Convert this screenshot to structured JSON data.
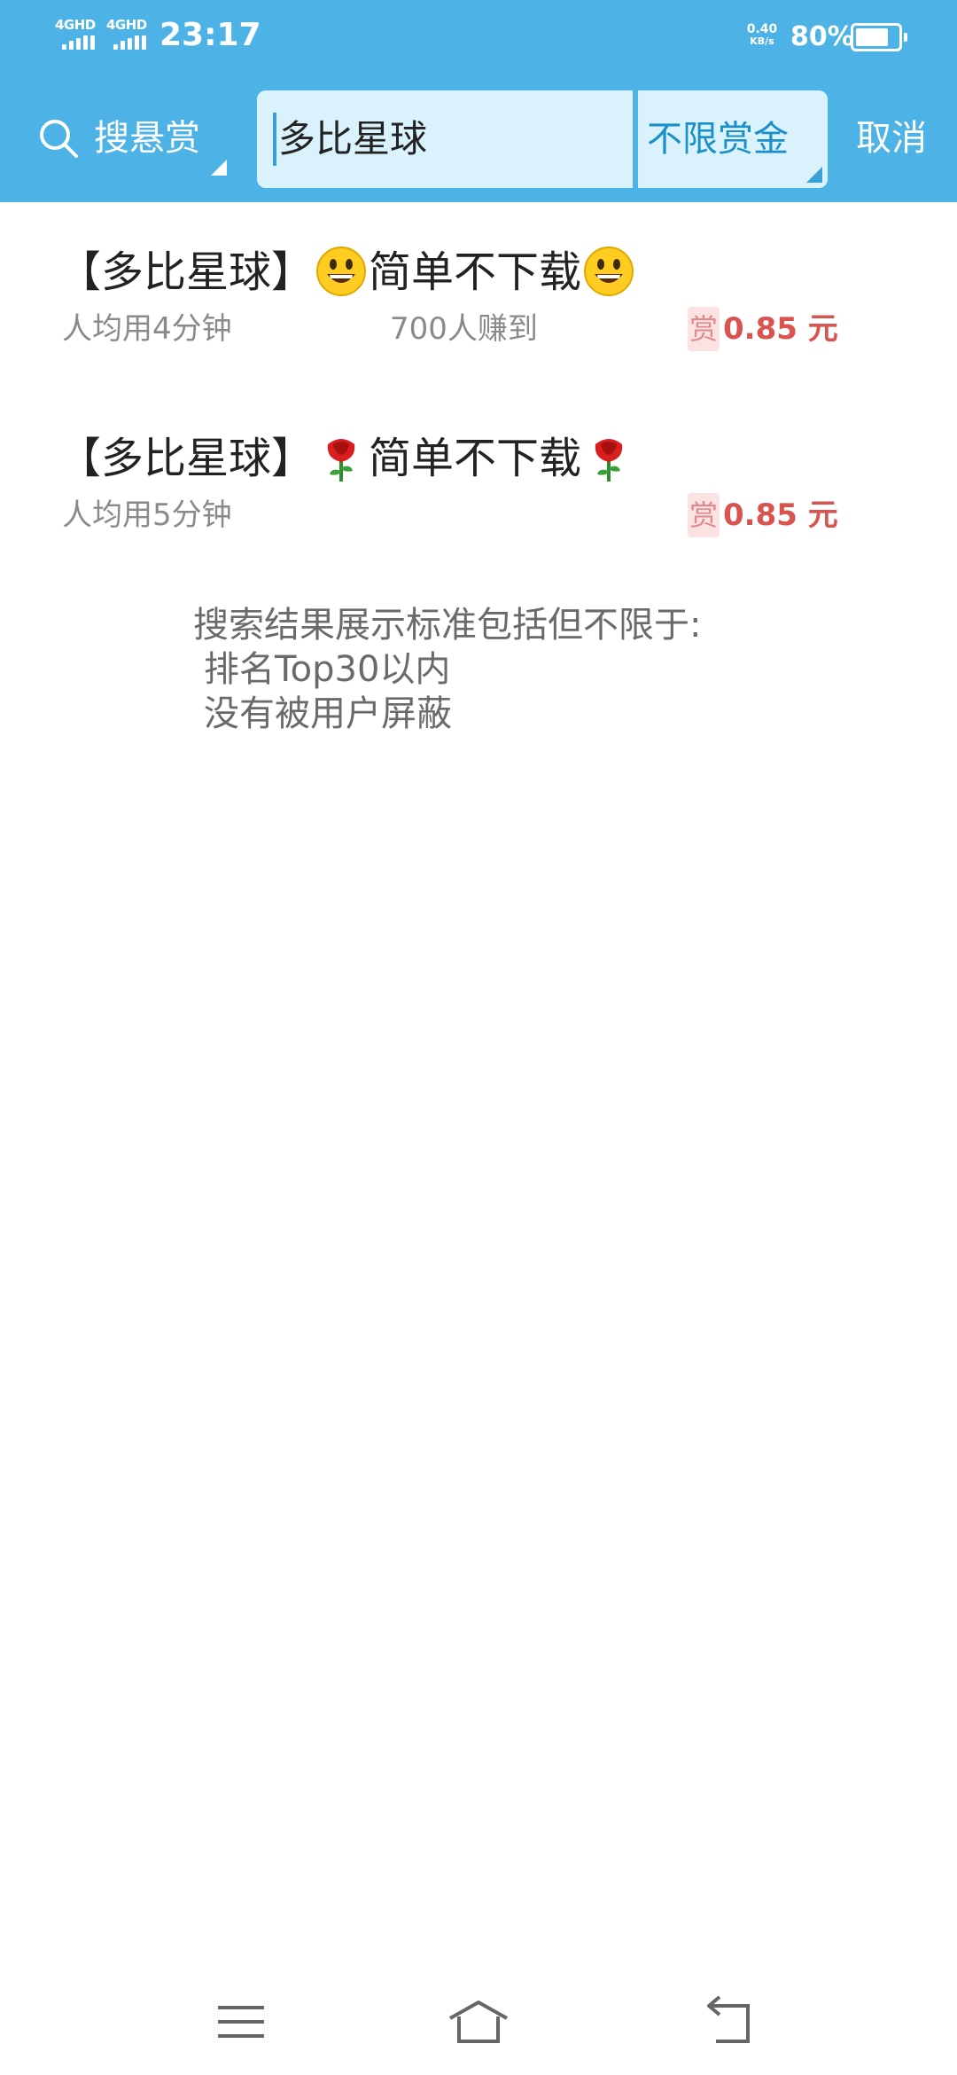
{
  "status_bar": {
    "signal1_label": "4GHD",
    "signal2_label": "4GHD",
    "time": "23:17",
    "net_speed_value": "0.40",
    "net_speed_unit": "KB/s",
    "battery_percent": "80%",
    "battery_level": 0.8
  },
  "search": {
    "scope_label": "搜悬赏",
    "query": "多比星球",
    "reward_filter": "不限赏金",
    "cancel_label": "取消"
  },
  "results": [
    {
      "title_prefix": "【多比星球】",
      "title_text": "简单不下载",
      "emoji": "grinning-face-icon",
      "time": "人均用4分钟",
      "earned": "700人赚到",
      "reward_tag": "赏",
      "reward": "0.85 元"
    },
    {
      "title_prefix": "【多比星球】",
      "title_text": "简单不下载",
      "emoji": "rose-icon",
      "time": "人均用5分钟",
      "earned": "",
      "reward_tag": "赏",
      "reward": "0.85 元"
    }
  ],
  "note": {
    "line1": "搜索结果展示标准包括但不限于:",
    "line2": "排名Top30以内",
    "line3": "没有被用户屏蔽"
  },
  "colors": {
    "header_bg": "#4db3e6",
    "search_bg": "#d9f2fb",
    "reward_red": "#d9534f",
    "link_blue": "#1a8fc9"
  },
  "nav_icons": [
    "menu-icon",
    "home-icon",
    "back-icon"
  ]
}
